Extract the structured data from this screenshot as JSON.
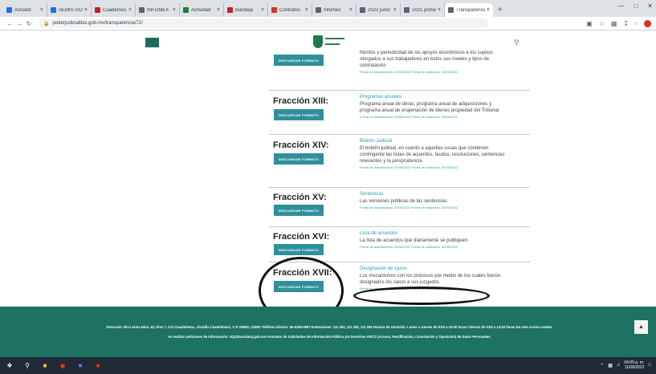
{
  "browser": {
    "tabs": [
      {
        "label": "Actualiz",
        "color": "#1a73e8",
        "active": false
      },
      {
        "label": "SEMIS GO",
        "color": "#1a73e8",
        "active": false
      },
      {
        "label": "Cuadernos",
        "color": "#c5221f",
        "active": false
      },
      {
        "label": "INFOMEX",
        "color": "#5f6368",
        "active": false
      },
      {
        "label": "Actividad",
        "color": "#188038",
        "active": false
      },
      {
        "label": "Bandeja",
        "color": "#c5221f",
        "active": false
      },
      {
        "label": "Contratos",
        "color": "#d93025",
        "active": false
      },
      {
        "label": "Infomex",
        "color": "#5f6368",
        "active": false
      },
      {
        "label": "2022 junio",
        "color": "#5f6368",
        "active": false
      },
      {
        "label": "2021 primer",
        "color": "#5f6368",
        "active": false
      },
      {
        "label": "Transparencia",
        "color": "#5f6368",
        "active": true
      }
    ],
    "new_tab": "+",
    "url": "poderjudicialtlax.gob.mx/transparencia/72/"
  },
  "fractions": [
    {
      "title": "",
      "button": "DESCARGAR FORMATO",
      "desc_title": "",
      "body_lines": [
        "Montos y periodicidad de los apoyos económicos a los sujetos",
        "otorgados a sus trabajadores en todos sus niveles y tipos de",
        "contratación"
      ],
      "meta": "Fecha de actualización: 30/06/2022 Fecha de validación: 30/06/2022"
    },
    {
      "title": "Fracción XIII:",
      "button": "DESCARGAR FORMATO",
      "desc_title": "Programas anuales",
      "body_lines": [
        "Programa anual de obras, programa anual de adquisiciones y",
        "programa anual de enajenación de bienes propiedad del Tribunal"
      ],
      "meta": "Fecha de actualización: 30/06/2022 Fecha de validación: 30/06/2022"
    },
    {
      "title": "Fracción XIV:",
      "button": "DESCARGAR FORMATO",
      "desc_title": "Boletín Judicial",
      "body_lines": [
        "El boletín judicial, en cuanto a aquellas cosas que contienen",
        "contingente las listas de acuerdos, laudos, resoluciones, sentencias",
        "relevantes y la jurisprudencia"
      ],
      "meta": "Fecha de actualización: 30/06/2022 Fecha de validación: 30/06/2022"
    },
    {
      "title": "Fracción XV:",
      "button": "DESCARGAR FORMATO",
      "desc_title": "Sentencias",
      "body_lines": [
        "Las versiones públicas de las sentencias"
      ],
      "meta": "Fecha de actualización: 30/06/2022 Fecha de validación: 30/06/2022"
    },
    {
      "title": "Fracción XVI:",
      "button": "DESCARGAR FORMATO",
      "desc_title": "Lista de acuerdos",
      "body_lines": [
        "La lista de acuerdos que diariamente se publiquen"
      ],
      "meta": "Fecha de actualización: 30/06/2022 Fecha de validación: 30/06/2022"
    },
    {
      "title": "Fracción XVII:",
      "button": "DESCARGAR FORMATO",
      "desc_title": "Designación de casos",
      "body_lines": [
        "Los mecanismos con los procesos por medio de los cuales fueron",
        "designados los casos a sus juzgados"
      ],
      "meta": "Fecha de actualización: 30/06/2022 Fecha de validación: 30/06/2022"
    }
  ],
  "footer": {
    "line1": "Dirección: Rio Lerma Núm. 63, Piso 7, Col Cuauhtémoc, Alcaldía Cuauhtémoc, C.P. 06500, CDMX   Teléfono directo: 55-9156-4997   Extensiones: 111 204, 111 205, 111 206   Horario de Atención: Lunes a Jueves de 9:00 a 15:00 horas   Viernes de 9:00 a 14:00 horas   En este correo cambie",
    "line2": "en realizar peticiones de información: stj@tlaxcalatsj.gob.mx   Formatos de Solicitudes de Información Pública y/o Derechos ARCO (Acceso, Rectificación, Cancelación y Oposición) de Datos Personales"
  },
  "taskbar": {
    "time": "04:00 p. m.",
    "date": "11/08/2022"
  }
}
